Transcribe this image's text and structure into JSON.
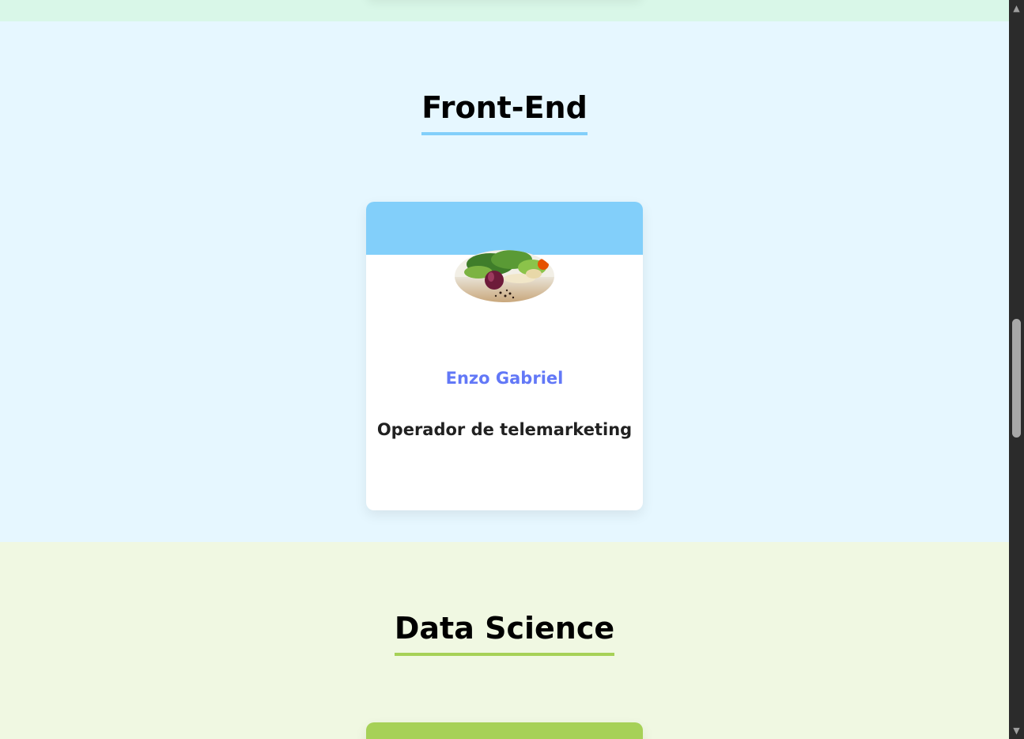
{
  "sections": {
    "frontend": {
      "title": "Front-End",
      "accent_color": "#82cffa",
      "background_color": "#e6f7ff",
      "cards": [
        {
          "name": "Enzo Gabriel",
          "role": "Operador de telemarketing",
          "photo_icon": "vegetables-photo"
        }
      ]
    },
    "datascience": {
      "title": "Data Science",
      "accent_color": "#a6d157",
      "background_color": "#f0f8e2"
    }
  },
  "colors": {
    "name_text": "#6278f7",
    "role_text": "#212121",
    "previous_section_bg": "#d9f7e8"
  },
  "scrollbar": {
    "up_icon": "triangle-up-icon",
    "down_icon": "triangle-down-icon"
  }
}
